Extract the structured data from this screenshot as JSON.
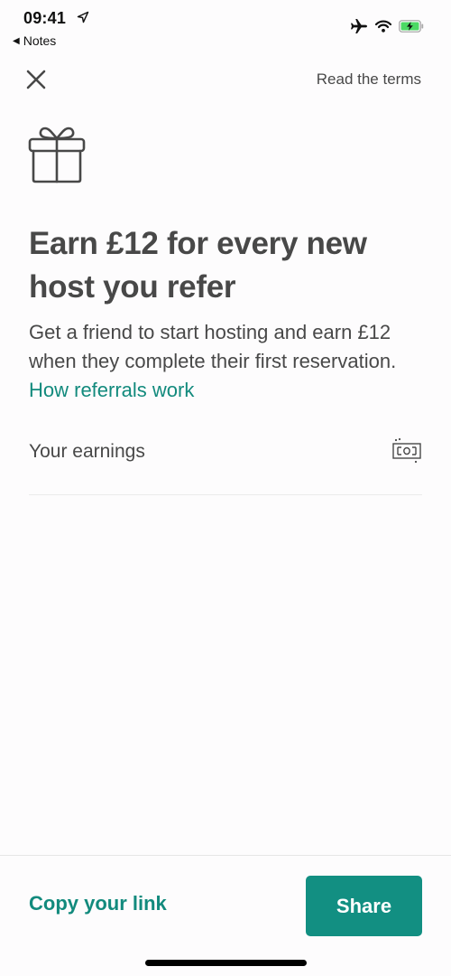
{
  "status_bar": {
    "time": "09:41",
    "back_app": "Notes",
    "icons": [
      "location-arrow-icon",
      "airplane-icon",
      "wifi-icon",
      "battery-charging-icon"
    ],
    "battery_color": "#4cd964"
  },
  "nav": {
    "close_icon": "close-icon",
    "terms_label": "Read the terms"
  },
  "hero": {
    "icon": "gift-icon",
    "headline": "Earn £12 for every new host you refer",
    "description": "Get a friend to start hosting and earn £12 when they complete their first reservation.",
    "link_label": "How referrals work"
  },
  "earnings": {
    "label": "Your earnings",
    "icon": "cash-icon"
  },
  "footer": {
    "copy_link_label": "Copy your link",
    "share_label": "Share"
  },
  "colors": {
    "accent": "#128f82",
    "text": "#484848"
  }
}
